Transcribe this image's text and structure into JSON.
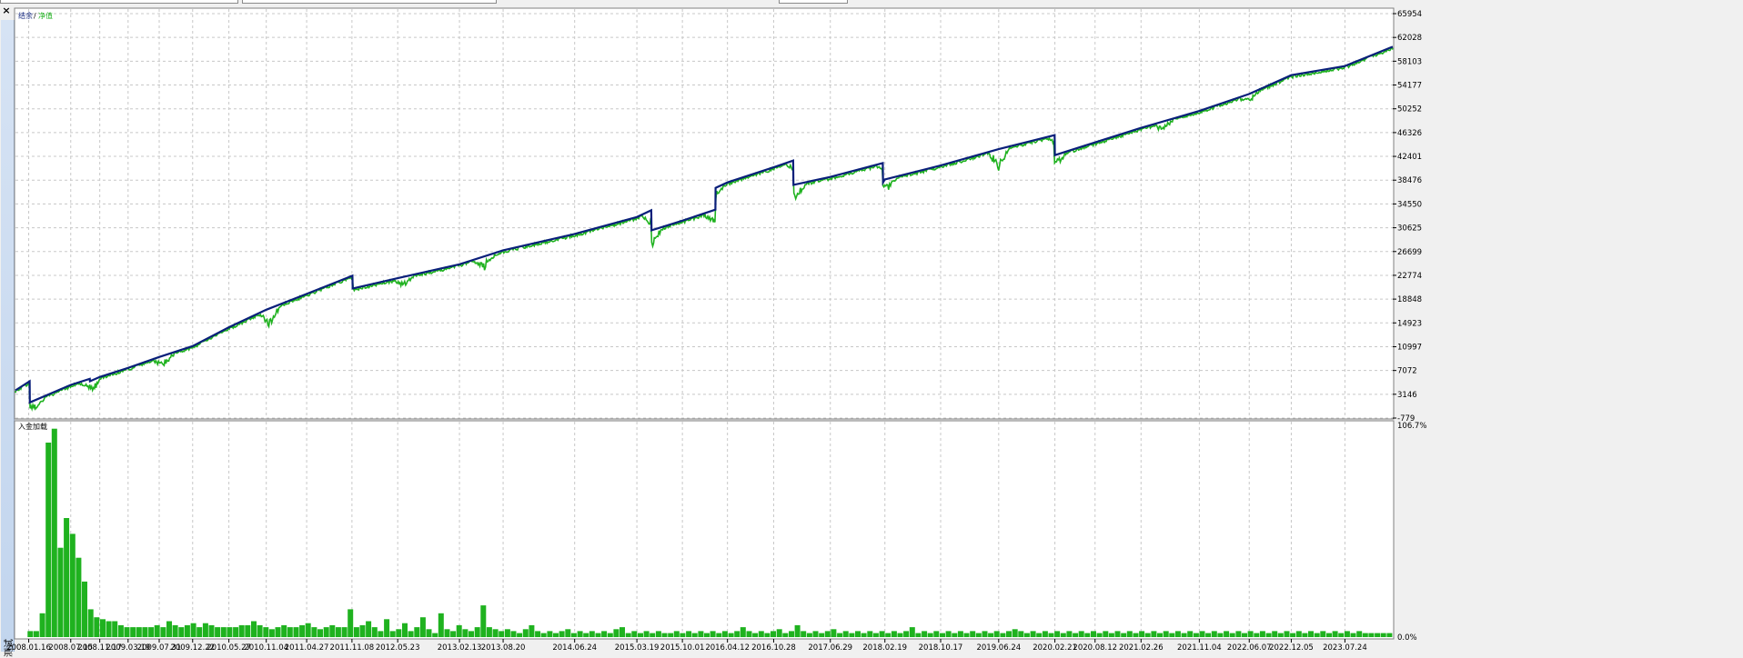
{
  "window": {
    "close_glyph": "×",
    "side_tab_label": "测试"
  },
  "colors": {
    "balance": "#0a1f7a",
    "equity": "#1fb21f",
    "grid": "#c8c8c8",
    "background": "#ffffff",
    "frame": "#808080"
  },
  "chart_data": [
    {
      "type": "line",
      "legend": [
        {
          "label": "结余",
          "color": "#0a1f7a"
        },
        {
          "label": "/",
          "color": "#000000"
        },
        {
          "label": "净值",
          "color": "#1fb21f"
        }
      ],
      "series": [
        {
          "name": "结余",
          "x": [
            "2007-11-20",
            "2008-01-20",
            "2008-01-21",
            "2008-07-15",
            "2008-10-05",
            "2008-10-06",
            "2008-11-17",
            "2009-03-19",
            "2009-07-31",
            "2009-12-22",
            "2010-05-27",
            "2010-11-04",
            "2011-04-27",
            "2011-11-10",
            "2011-11-11",
            "2012-05-23",
            "2013-02-13",
            "2013-08-20",
            "2014-06-24",
            "2015-03-19",
            "2015-05-20",
            "2015-05-21",
            "2015-10-01",
            "2016-02-20",
            "2016-02-21",
            "2016-04-12",
            "2016-10-28",
            "2017-01-20",
            "2017-01-21",
            "2017-06-29",
            "2018-02-10",
            "2018-02-11",
            "2018-02-19",
            "2018-10-17",
            "2019-06-24",
            "2020-02-20",
            "2020-02-21",
            "2020-08-12",
            "2021-02-26",
            "2021-11-04",
            "2022-06-07",
            "2022-12-05",
            "2023-07-24",
            "2024-02-15"
          ],
          "values": [
            3800,
            5300,
            1800,
            4700,
            5700,
            5300,
            6000,
            7500,
            9300,
            11100,
            14200,
            17100,
            19700,
            22700,
            20600,
            22300,
            24600,
            26900,
            29600,
            32400,
            33500,
            30200,
            31800,
            33600,
            37200,
            38100,
            40600,
            41700,
            37700,
            39000,
            41300,
            38100,
            38600,
            40900,
            43600,
            45900,
            42600,
            44700,
            47100,
            49900,
            52700,
            55800,
            57300,
            60500
          ]
        },
        {
          "name": "净值",
          "x": [
            "2008-02-20",
            "2008-10-10",
            "2009-08-20",
            "2010-11-20",
            "2012-06-15",
            "2013-06-01",
            "2015-05-25",
            "2016-02-15",
            "2017-02-01",
            "2018-03-01",
            "2019-06-24",
            "2020-03-01",
            "2021-06-01",
            "2022-06-07"
          ],
          "drawdowns": [
            1500,
            2200,
            1600,
            3100,
            1600,
            1900,
            3100,
            2100,
            2600,
            1600,
            3600,
            1600,
            1300,
            1100
          ]
        },
        {
          "name": "入金加载",
          "values_percent": [
            0,
            0,
            3,
            3,
            12,
            98,
            105,
            45,
            60,
            52,
            40,
            28,
            14,
            10,
            9,
            8,
            8,
            6,
            5,
            5,
            5,
            5,
            5,
            6,
            5,
            8,
            6,
            5,
            6,
            7,
            5,
            7,
            6,
            5,
            5,
            5,
            5,
            6,
            6,
            8,
            6,
            5,
            4,
            5,
            6,
            5,
            5,
            6,
            7,
            5,
            4,
            5,
            6,
            5,
            5,
            14,
            5,
            6,
            8,
            5,
            3,
            9,
            3,
            4,
            7,
            3,
            5,
            10,
            4,
            2,
            12,
            4,
            3,
            6,
            4,
            3,
            5,
            16,
            5,
            4,
            3,
            4,
            3,
            2,
            4,
            6,
            3,
            2,
            3,
            2,
            3,
            4,
            2,
            3,
            2,
            3,
            2,
            3,
            2,
            4,
            5,
            2,
            3,
            2,
            3,
            2,
            3,
            2,
            2,
            3,
            2,
            3,
            2,
            3,
            2,
            3,
            2,
            3,
            2,
            3,
            5,
            3,
            2,
            3,
            2,
            3,
            4,
            2,
            3,
            6,
            3,
            2,
            3,
            2,
            3,
            4,
            2,
            3,
            2,
            3,
            2,
            3,
            2,
            3,
            2,
            3,
            2,
            3,
            5,
            2,
            3,
            2,
            3,
            2,
            3,
            2,
            3,
            2,
            3,
            2,
            3,
            2,
            3,
            2,
            3,
            4,
            3,
            2,
            3,
            2,
            3,
            2,
            3,
            2,
            3,
            2,
            3,
            2,
            3,
            2,
            3,
            2,
            3,
            2,
            3,
            2,
            3,
            2,
            3,
            2,
            3,
            2,
            3,
            2,
            3,
            2,
            3,
            2,
            3,
            2,
            3,
            2,
            3,
            2,
            3,
            2,
            3,
            2,
            3,
            2,
            3,
            2,
            3,
            2,
            3,
            2,
            3,
            2,
            3,
            2,
            3,
            2,
            3,
            2,
            2,
            2,
            2,
            2
          ]
        }
      ],
      "y_ticks": [
        "65954",
        "62028",
        "58103",
        "54177",
        "50252",
        "46326",
        "42401",
        "38476",
        "34550",
        "30625",
        "26699",
        "22774",
        "18848",
        "14923",
        "10997",
        "7072",
        "3146",
        "-779"
      ],
      "ylim": [
        -779,
        65954
      ],
      "lower_panel": {
        "label": "入金加载",
        "y_ticks": [
          "106.7%",
          "0.0%"
        ],
        "ylim": [
          0,
          106.7
        ]
      },
      "x_ticks": [
        "2008.01.16",
        "2008.07.15",
        "2008.11.17",
        "2009.03.19",
        "2009.07.31",
        "2009.12.22",
        "2010.05.27",
        "2010.11.04",
        "2011.04.27",
        "2011.11.08",
        "2012.05.23",
        "2013.02.13",
        "2013.08.20",
        "2014.06.24",
        "2015.03.19",
        "2015.10.01",
        "2016.04.12",
        "2016.10.28",
        "2017.06.29",
        "2018.02.19",
        "2018.10.17",
        "2019.06.24",
        "2020.02.21",
        "2020.08.12",
        "2021.02.26",
        "2021.11.04",
        "2022.06.07",
        "2022.12.05",
        "2023.07.24"
      ],
      "xlim": [
        "2007-11-20",
        "2024-02-15"
      ],
      "grid": true
    }
  ]
}
